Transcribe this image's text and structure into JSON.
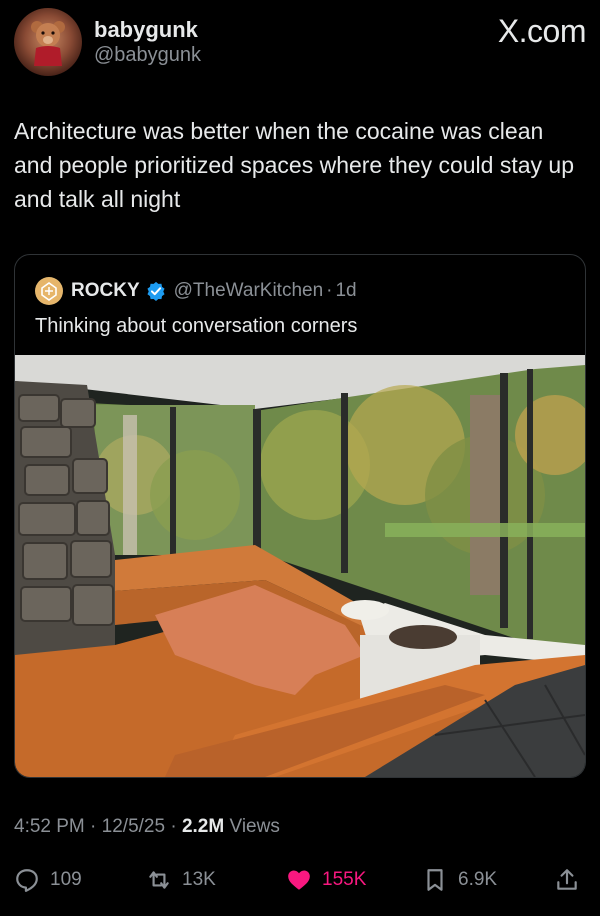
{
  "author": {
    "name": "babygunk",
    "handle": "@babygunk"
  },
  "brand": "X.com",
  "tweet": {
    "text": "Architecture was better when the cocaine was clean and people prioritized spaces where they could stay up and talk all night"
  },
  "quoted": {
    "name": "ROCKY",
    "handle": "@TheWarKitchen",
    "separator": "·",
    "time": "1d",
    "text": "Thinking about conversation corners"
  },
  "meta": {
    "time": "4:52 PM",
    "sep1": "·",
    "date": "12/5/25",
    "sep2": "·",
    "views_count": "2.2M",
    "views_label": "Views"
  },
  "actions": {
    "replies": "109",
    "reposts": "13K",
    "likes": "155K",
    "bookmarks": "6.9K"
  },
  "colors": {
    "like": "#f91880",
    "verified": "#1d9bf0",
    "muted": "#8b9096"
  }
}
